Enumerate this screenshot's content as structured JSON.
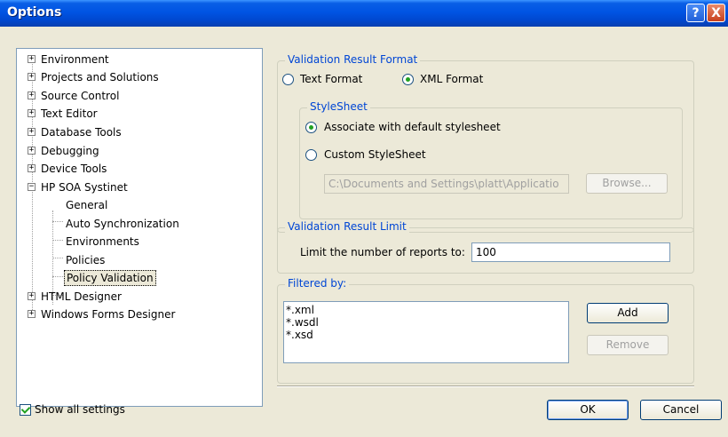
{
  "window": {
    "title": "Options",
    "help_label": "?",
    "close_label": "X"
  },
  "tree": {
    "items": [
      {
        "label": "Environment",
        "expander": "+"
      },
      {
        "label": "Projects and Solutions",
        "expander": "+"
      },
      {
        "label": "Source Control",
        "expander": "+"
      },
      {
        "label": "Text Editor",
        "expander": "+"
      },
      {
        "label": "Database Tools",
        "expander": "+"
      },
      {
        "label": "Debugging",
        "expander": "+"
      },
      {
        "label": "Device Tools",
        "expander": "+"
      },
      {
        "label": "HP SOA Systinet",
        "expander": "−"
      },
      {
        "label": "General"
      },
      {
        "label": "Auto Synchronization"
      },
      {
        "label": "Environments"
      },
      {
        "label": "Policies"
      },
      {
        "label": "Policy Validation"
      },
      {
        "label": "HTML Designer",
        "expander": "+"
      },
      {
        "label": "Windows Forms Designer",
        "expander": "+"
      }
    ]
  },
  "format_group": {
    "title": "Validation Result Format",
    "text_format_label": "Text Format",
    "xml_format_label": "XML Format",
    "selected": "xml"
  },
  "stylesheet_group": {
    "title": "StyleSheet",
    "default_label": "Associate with default stylesheet",
    "custom_label": "Custom StyleSheet",
    "selected": "default",
    "path_value": "C:\\Documents and Settings\\platt\\Applicatio",
    "browse_label": "Browse..."
  },
  "limit_group": {
    "title": "Validation Result Limit",
    "label": "Limit the number of reports to:",
    "value": "100"
  },
  "filter_group": {
    "title": "Filtered by:",
    "items": [
      "*.xml",
      "*.wsdl",
      "*.xsd"
    ],
    "add_label": "Add",
    "remove_label": "Remove"
  },
  "footer": {
    "show_all_label": "Show all settings",
    "show_all_checked": true,
    "ok_label": "OK",
    "cancel_label": "Cancel"
  }
}
